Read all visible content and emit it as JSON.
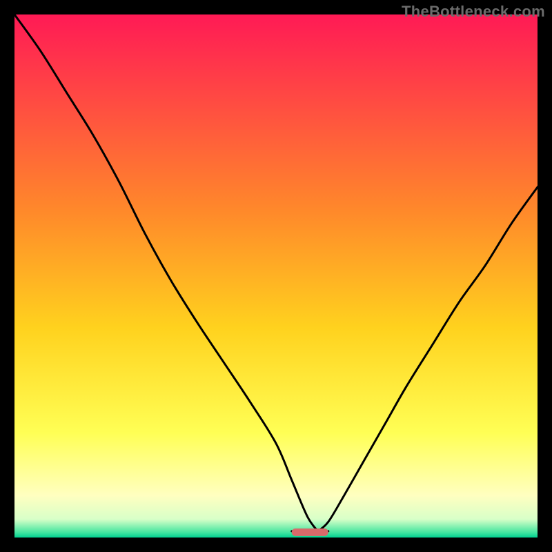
{
  "watermark": "TheBottleneck.com",
  "chart_data": {
    "type": "line",
    "title": "",
    "xlabel": "",
    "ylabel": "",
    "xlim": [
      0,
      100
    ],
    "ylim": [
      0,
      100
    ],
    "grid": false,
    "legend": false,
    "annotations": [],
    "background_gradient": [
      {
        "stop": 0.0,
        "color": "#ff1a55"
      },
      {
        "stop": 0.38,
        "color": "#ff8a2a"
      },
      {
        "stop": 0.6,
        "color": "#ffd21e"
      },
      {
        "stop": 0.8,
        "color": "#ffff55"
      },
      {
        "stop": 0.92,
        "color": "#ffffc0"
      },
      {
        "stop": 0.965,
        "color": "#d8ffc8"
      },
      {
        "stop": 0.99,
        "color": "#45e6a0"
      },
      {
        "stop": 1.0,
        "color": "#00d090"
      }
    ],
    "marker": {
      "x_center": 56.5,
      "width": 7,
      "y": 1,
      "color": "#d86a6a"
    },
    "series": [
      {
        "name": "left-curve",
        "x": [
          0,
          5,
          10,
          15,
          20,
          25,
          30,
          35,
          40,
          45,
          50,
          53,
          56,
          58
        ],
        "y": [
          100,
          93,
          85,
          77,
          68,
          58,
          49,
          41,
          33.5,
          26,
          18,
          11,
          4,
          1.2
        ]
      },
      {
        "name": "floor",
        "x": [
          53,
          60
        ],
        "y": [
          1.2,
          1.2
        ]
      },
      {
        "name": "right-curve",
        "x": [
          58,
          60,
          63,
          67,
          71,
          75,
          80,
          85,
          90,
          95,
          100
        ],
        "y": [
          1.2,
          3,
          8,
          15,
          22,
          29,
          37,
          45,
          52,
          60,
          67
        ]
      }
    ]
  }
}
